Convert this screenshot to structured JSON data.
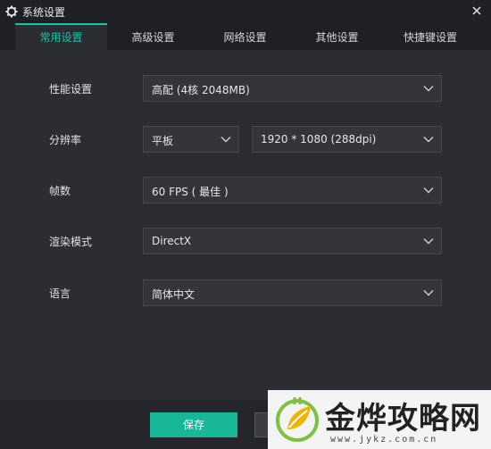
{
  "window": {
    "title": "系统设置"
  },
  "tabs": [
    {
      "label": "常用设置",
      "active": true
    },
    {
      "label": "高级设置"
    },
    {
      "label": "网络设置"
    },
    {
      "label": "其他设置"
    },
    {
      "label": "快捷键设置"
    }
  ],
  "settings": {
    "performance": {
      "label": "性能设置",
      "value": "高配 (4核 2048MB)"
    },
    "resolution": {
      "label": "分辨率",
      "device": "平板",
      "value": "1920 * 1080 (288dpi)"
    },
    "fps": {
      "label": "帧数",
      "value": "60 FPS ( 最佳 )"
    },
    "render": {
      "label": "渲染模式",
      "value": "DirectX"
    },
    "language": {
      "label": "语言",
      "value": "简体中文"
    }
  },
  "footer": {
    "save_label": "保存"
  },
  "watermark": {
    "name": "金烨攻略网",
    "url": "www.jykz.com.cn"
  },
  "colors": {
    "accent": "#16c5a6",
    "save_button": "#17b797",
    "background": "#2b2d33",
    "titlebar": "#1f2025"
  },
  "icons": {
    "title": "gear-icon",
    "close": "close-icon",
    "dropdown": "chevron-down-icon",
    "watermark": "leaf-plug-logo"
  }
}
